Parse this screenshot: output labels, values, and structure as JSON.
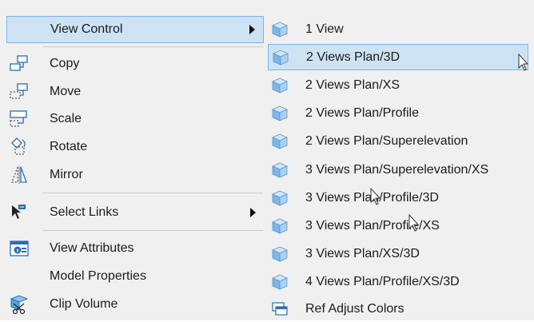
{
  "main_menu": {
    "items": [
      {
        "label": "View Control",
        "icon": "view-control-icon",
        "has_submenu": true,
        "highlighted": true
      },
      {
        "label": "Copy",
        "icon": "copy-icon"
      },
      {
        "label": "Move",
        "icon": "move-icon"
      },
      {
        "label": "Scale",
        "icon": "scale-icon"
      },
      {
        "label": "Rotate",
        "icon": "rotate-icon"
      },
      {
        "label": "Mirror",
        "icon": "mirror-icon"
      },
      {
        "label": "Select Links",
        "icon": "select-links-icon",
        "has_submenu": true
      },
      {
        "label": "View Attributes",
        "icon": "view-attributes-icon"
      },
      {
        "label": "Model Properties",
        "icon": ""
      },
      {
        "label": "Clip Volume",
        "icon": "clip-volume-icon"
      }
    ]
  },
  "submenu": {
    "items": [
      {
        "label": "1 View",
        "icon": "cube-icon"
      },
      {
        "label": "2 Views Plan/3D",
        "icon": "cube-icon",
        "highlighted": true
      },
      {
        "label": "2 Views Plan/XS",
        "icon": "cube-icon"
      },
      {
        "label": "2 Views Plan/Profile",
        "icon": "cube-icon"
      },
      {
        "label": "2 Views Plan/Superelevation",
        "icon": "cube-icon"
      },
      {
        "label": "3 Views Plan/Superelevation/XS",
        "icon": "cube-icon"
      },
      {
        "label": "3 Views Plan/Profile/3D",
        "icon": "cube-icon"
      },
      {
        "label": "3 Views Plan/Profile/XS",
        "icon": "cube-icon"
      },
      {
        "label": "3 Views Plan/XS/3D",
        "icon": "cube-icon"
      },
      {
        "label": "4 Views Plan/Profile/XS/3D",
        "icon": "cube-icon"
      },
      {
        "label": "Ref Adjust Colors",
        "icon": "ref-adjust-colors-icon"
      }
    ]
  },
  "colors": {
    "menu_bg": "#f0f0f0",
    "highlight_bg": "#cde3f3",
    "highlight_border": "#7eb4ea",
    "separator": "#c9c9c9",
    "cube_face": "#8fc3f0"
  }
}
